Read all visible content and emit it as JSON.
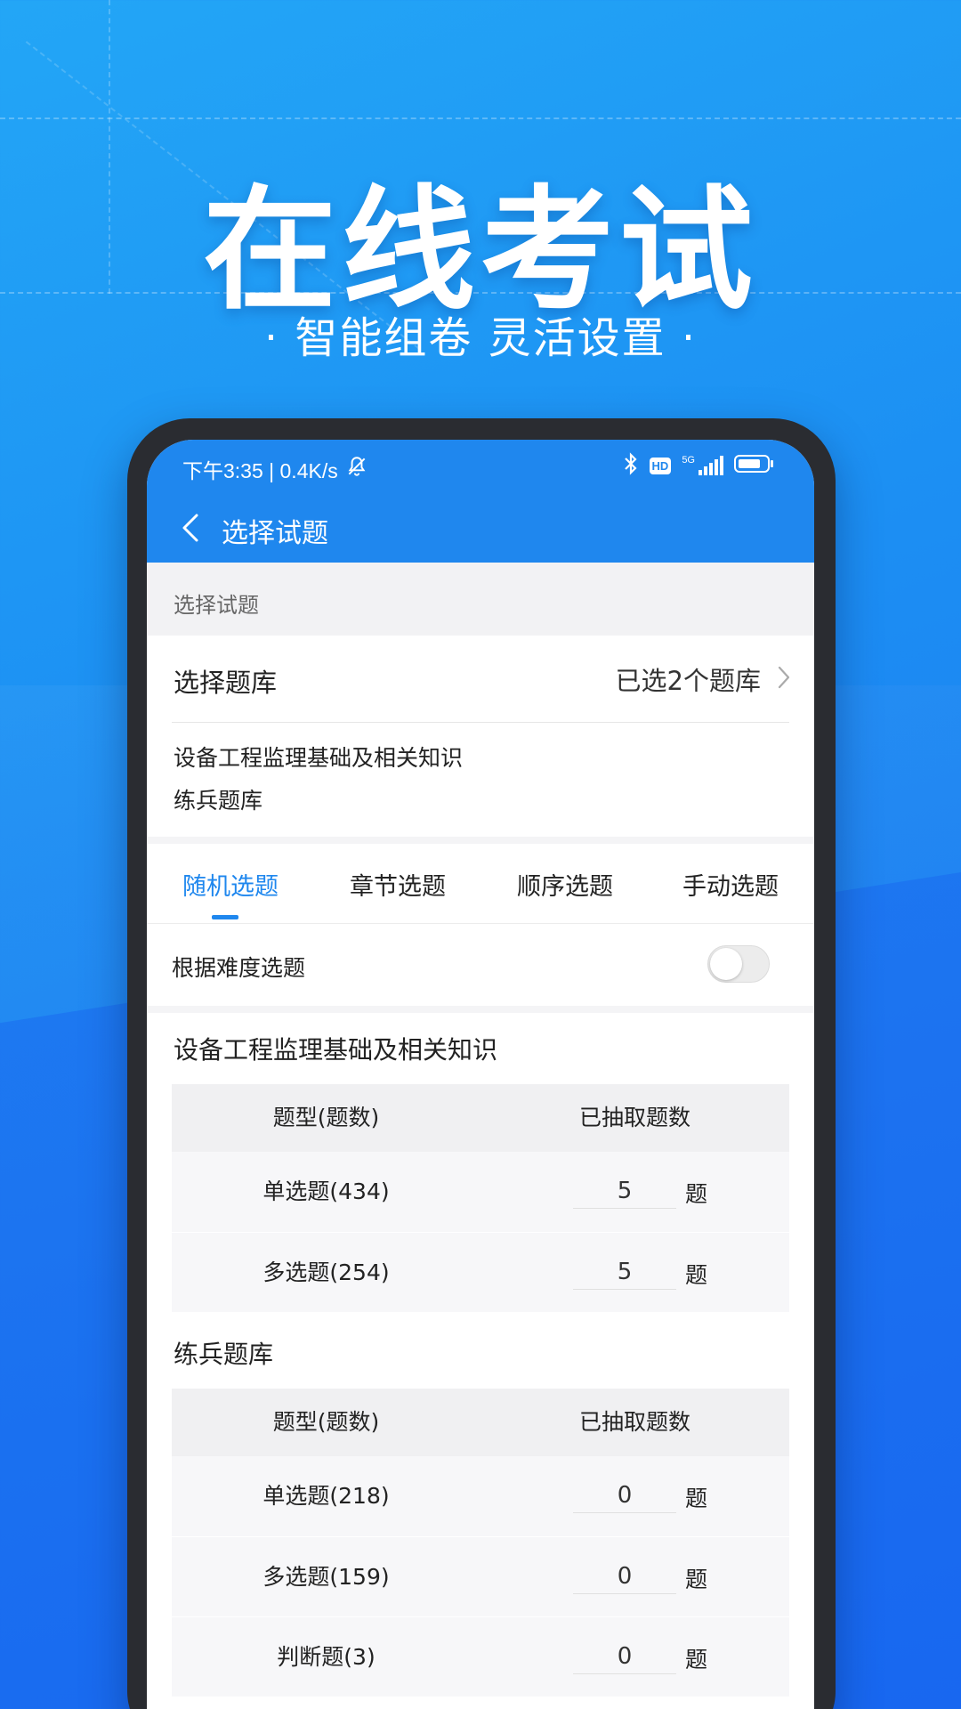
{
  "promo": {
    "headline": "在线考试",
    "subline": "· 智能组卷  灵活设置 ·"
  },
  "statusbar": {
    "time_speed": "下午3:35 | 0.4K/s",
    "network": "5G",
    "hd": "HD"
  },
  "appbar": {
    "title": "选择试题"
  },
  "section_header": "选择试题",
  "bank_select": {
    "label": "选择题库",
    "value": "已选2个题库"
  },
  "selected_banks": [
    "设备工程监理基础及相关知识",
    "练兵题库"
  ],
  "tabs": [
    {
      "label": "随机选题",
      "active": true
    },
    {
      "label": "章节选题",
      "active": false
    },
    {
      "label": "顺序选题",
      "active": false
    },
    {
      "label": "手动选题",
      "active": false
    }
  ],
  "difficulty": {
    "label": "根据难度选题",
    "enabled": false
  },
  "banks": [
    {
      "title": "设备工程监理基础及相关知识",
      "header": {
        "type": "题型(题数)",
        "drawn": "已抽取题数"
      },
      "rows": [
        {
          "type": "单选题(434)",
          "count": "5",
          "unit": "题"
        },
        {
          "type": "多选题(254)",
          "count": "5",
          "unit": "题"
        }
      ]
    },
    {
      "title": "练兵题库",
      "header": {
        "type": "题型(题数)",
        "drawn": "已抽取题数"
      },
      "rows": [
        {
          "type": "单选题(218)",
          "count": "0",
          "unit": "题"
        },
        {
          "type": "多选题(159)",
          "count": "0",
          "unit": "题"
        },
        {
          "type": "判断题(3)",
          "count": "0",
          "unit": "题"
        }
      ]
    }
  ],
  "colors": {
    "accent": "#1f87ee",
    "background_top": "#23a6f6",
    "background_bottom": "#1a70f5"
  }
}
